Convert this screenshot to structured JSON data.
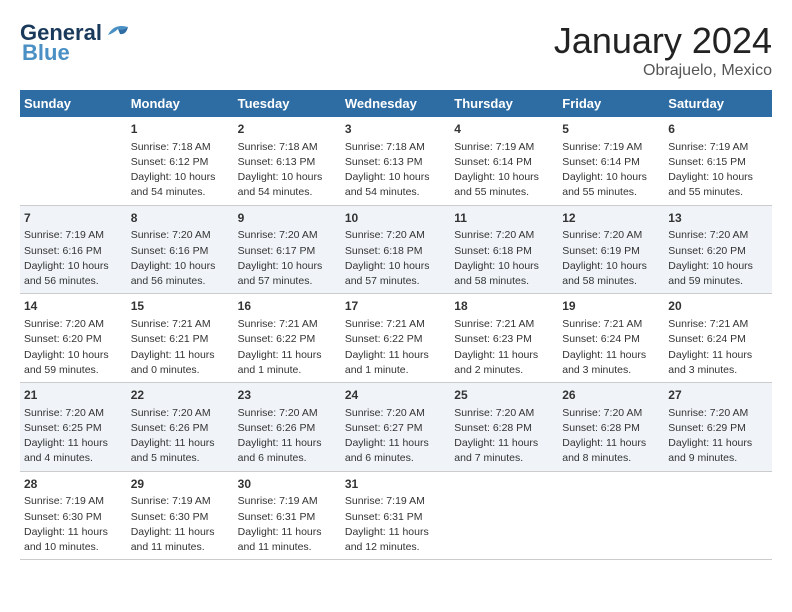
{
  "header": {
    "logo_line1": "General",
    "logo_line2": "Blue",
    "month": "January 2024",
    "location": "Obrajuelo, Mexico"
  },
  "weekdays": [
    "Sunday",
    "Monday",
    "Tuesday",
    "Wednesday",
    "Thursday",
    "Friday",
    "Saturday"
  ],
  "weeks": [
    [
      {
        "day": "",
        "info": ""
      },
      {
        "day": "1",
        "info": "Sunrise: 7:18 AM\nSunset: 6:12 PM\nDaylight: 10 hours\nand 54 minutes."
      },
      {
        "day": "2",
        "info": "Sunrise: 7:18 AM\nSunset: 6:13 PM\nDaylight: 10 hours\nand 54 minutes."
      },
      {
        "day": "3",
        "info": "Sunrise: 7:18 AM\nSunset: 6:13 PM\nDaylight: 10 hours\nand 54 minutes."
      },
      {
        "day": "4",
        "info": "Sunrise: 7:19 AM\nSunset: 6:14 PM\nDaylight: 10 hours\nand 55 minutes."
      },
      {
        "day": "5",
        "info": "Sunrise: 7:19 AM\nSunset: 6:14 PM\nDaylight: 10 hours\nand 55 minutes."
      },
      {
        "day": "6",
        "info": "Sunrise: 7:19 AM\nSunset: 6:15 PM\nDaylight: 10 hours\nand 55 minutes."
      }
    ],
    [
      {
        "day": "7",
        "info": "Sunrise: 7:19 AM\nSunset: 6:16 PM\nDaylight: 10 hours\nand 56 minutes."
      },
      {
        "day": "8",
        "info": "Sunrise: 7:20 AM\nSunset: 6:16 PM\nDaylight: 10 hours\nand 56 minutes."
      },
      {
        "day": "9",
        "info": "Sunrise: 7:20 AM\nSunset: 6:17 PM\nDaylight: 10 hours\nand 57 minutes."
      },
      {
        "day": "10",
        "info": "Sunrise: 7:20 AM\nSunset: 6:18 PM\nDaylight: 10 hours\nand 57 minutes."
      },
      {
        "day": "11",
        "info": "Sunrise: 7:20 AM\nSunset: 6:18 PM\nDaylight: 10 hours\nand 58 minutes."
      },
      {
        "day": "12",
        "info": "Sunrise: 7:20 AM\nSunset: 6:19 PM\nDaylight: 10 hours\nand 58 minutes."
      },
      {
        "day": "13",
        "info": "Sunrise: 7:20 AM\nSunset: 6:20 PM\nDaylight: 10 hours\nand 59 minutes."
      }
    ],
    [
      {
        "day": "14",
        "info": "Sunrise: 7:20 AM\nSunset: 6:20 PM\nDaylight: 10 hours\nand 59 minutes."
      },
      {
        "day": "15",
        "info": "Sunrise: 7:21 AM\nSunset: 6:21 PM\nDaylight: 11 hours\nand 0 minutes."
      },
      {
        "day": "16",
        "info": "Sunrise: 7:21 AM\nSunset: 6:22 PM\nDaylight: 11 hours\nand 1 minute."
      },
      {
        "day": "17",
        "info": "Sunrise: 7:21 AM\nSunset: 6:22 PM\nDaylight: 11 hours\nand 1 minute."
      },
      {
        "day": "18",
        "info": "Sunrise: 7:21 AM\nSunset: 6:23 PM\nDaylight: 11 hours\nand 2 minutes."
      },
      {
        "day": "19",
        "info": "Sunrise: 7:21 AM\nSunset: 6:24 PM\nDaylight: 11 hours\nand 3 minutes."
      },
      {
        "day": "20",
        "info": "Sunrise: 7:21 AM\nSunset: 6:24 PM\nDaylight: 11 hours\nand 3 minutes."
      }
    ],
    [
      {
        "day": "21",
        "info": "Sunrise: 7:20 AM\nSunset: 6:25 PM\nDaylight: 11 hours\nand 4 minutes."
      },
      {
        "day": "22",
        "info": "Sunrise: 7:20 AM\nSunset: 6:26 PM\nDaylight: 11 hours\nand 5 minutes."
      },
      {
        "day": "23",
        "info": "Sunrise: 7:20 AM\nSunset: 6:26 PM\nDaylight: 11 hours\nand 6 minutes."
      },
      {
        "day": "24",
        "info": "Sunrise: 7:20 AM\nSunset: 6:27 PM\nDaylight: 11 hours\nand 6 minutes."
      },
      {
        "day": "25",
        "info": "Sunrise: 7:20 AM\nSunset: 6:28 PM\nDaylight: 11 hours\nand 7 minutes."
      },
      {
        "day": "26",
        "info": "Sunrise: 7:20 AM\nSunset: 6:28 PM\nDaylight: 11 hours\nand 8 minutes."
      },
      {
        "day": "27",
        "info": "Sunrise: 7:20 AM\nSunset: 6:29 PM\nDaylight: 11 hours\nand 9 minutes."
      }
    ],
    [
      {
        "day": "28",
        "info": "Sunrise: 7:19 AM\nSunset: 6:30 PM\nDaylight: 11 hours\nand 10 minutes."
      },
      {
        "day": "29",
        "info": "Sunrise: 7:19 AM\nSunset: 6:30 PM\nDaylight: 11 hours\nand 11 minutes."
      },
      {
        "day": "30",
        "info": "Sunrise: 7:19 AM\nSunset: 6:31 PM\nDaylight: 11 hours\nand 11 minutes."
      },
      {
        "day": "31",
        "info": "Sunrise: 7:19 AM\nSunset: 6:31 PM\nDaylight: 11 hours\nand 12 minutes."
      },
      {
        "day": "",
        "info": ""
      },
      {
        "day": "",
        "info": ""
      },
      {
        "day": "",
        "info": ""
      }
    ]
  ]
}
